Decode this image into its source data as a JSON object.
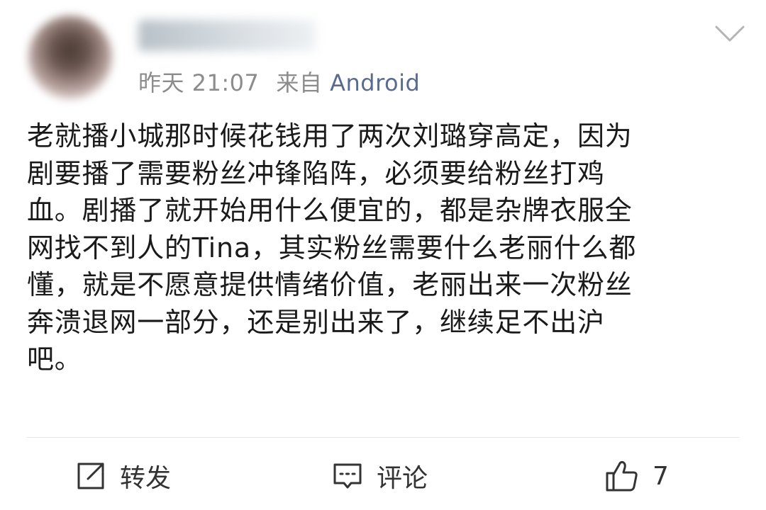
{
  "post": {
    "username": "",
    "timestamp": "昨天 21:07",
    "source_prefix": "来自",
    "source": "Android",
    "lines": [
      "老就播小城那时候花钱用了两次刘璐穿高定，因为",
      "剧要播了需要粉丝冲锋陷阵，必须要给粉丝打鸡",
      "血。剧播了就开始用什么便宜的，都是杂牌衣服全",
      "网找不到人的Tina，其实粉丝需要什么老丽什么都",
      "懂，就是不愿意提供情绪价值，老丽出来一次粉丝",
      "奔溃退网一部分，还是别出来了，继续足不出沪",
      "吧。"
    ]
  },
  "actions": {
    "repost_label": "转发",
    "comment_label": "评论",
    "like_count": "7"
  },
  "icons": {
    "menu": "chevron-down-icon",
    "repost": "repost-icon",
    "comment": "comment-icon",
    "like": "thumbs-up-icon"
  },
  "colors": {
    "source_link": "#5b6b8f",
    "meta_text": "#8c8c8c",
    "icon_stroke": "#333333"
  }
}
